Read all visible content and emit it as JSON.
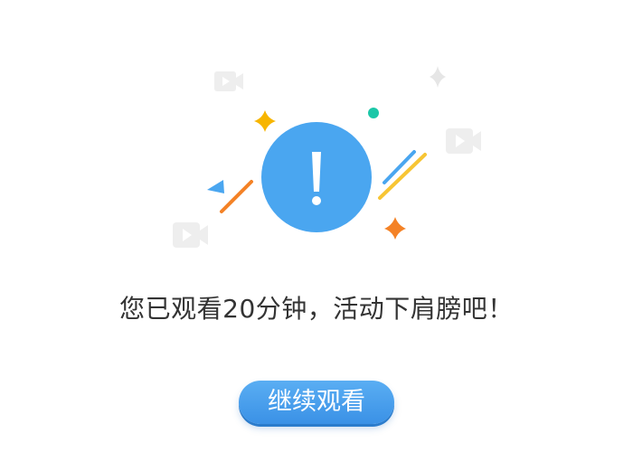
{
  "dialog": {
    "message": "您已观看20分钟，活动下肩膀吧！",
    "continue_label": "继续观看"
  },
  "colors": {
    "accent": "#4aa6f0",
    "button": "#3a91e6",
    "text": "#333333",
    "sparkle_yellow": "#f7b500",
    "sparkle_orange": "#f48226",
    "teal_dot": "#1cc7a8",
    "stripe_blue": "#4aa6f0",
    "stripe_yellow": "#f7c534",
    "video_icon_gray": "#eeeeee"
  },
  "icons": [
    "video-camera-icon",
    "exclamation-icon",
    "sparkle-icon",
    "triangle-icon",
    "stripe-decoration",
    "dot-decoration"
  ]
}
